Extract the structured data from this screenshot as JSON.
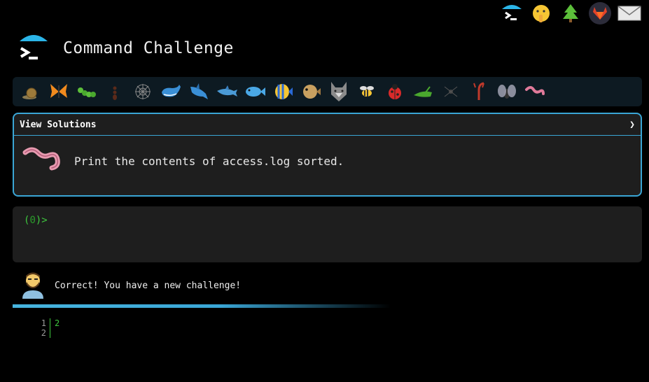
{
  "app": {
    "title": "Command Challenge"
  },
  "top_icons": [
    "terminal-umbrella-icon",
    "shushing-face-icon",
    "tree-icon",
    "gitlab-icon",
    "envelope-icon"
  ],
  "critters": [
    "snail",
    "butterfly",
    "caterpillar",
    "ant",
    "spider-web",
    "whale",
    "shark",
    "dolphin",
    "fish",
    "tropical-fish",
    "blowfish",
    "wolf",
    "bee",
    "ladybug",
    "cricket",
    "spider",
    "scorpion",
    "fly",
    "worm"
  ],
  "challenge": {
    "view_solutions_label": "View Solutions",
    "toggle_glyph": "❯",
    "text": "Print the contents of access.log sorted."
  },
  "terminal": {
    "prompt_open": "(",
    "prompt_count": "0",
    "prompt_close": ")>"
  },
  "feedback": {
    "message": "Correct! You have a new challenge!"
  },
  "progress": {
    "fraction": 0.6
  },
  "editor": {
    "lines": [
      {
        "number": "1",
        "text": "2"
      },
      {
        "number": "2",
        "text": ""
      }
    ]
  },
  "colors": {
    "accent": "#3aa6d6",
    "prompt_green": "#3ec83e",
    "panel": "#1e1e1e"
  }
}
